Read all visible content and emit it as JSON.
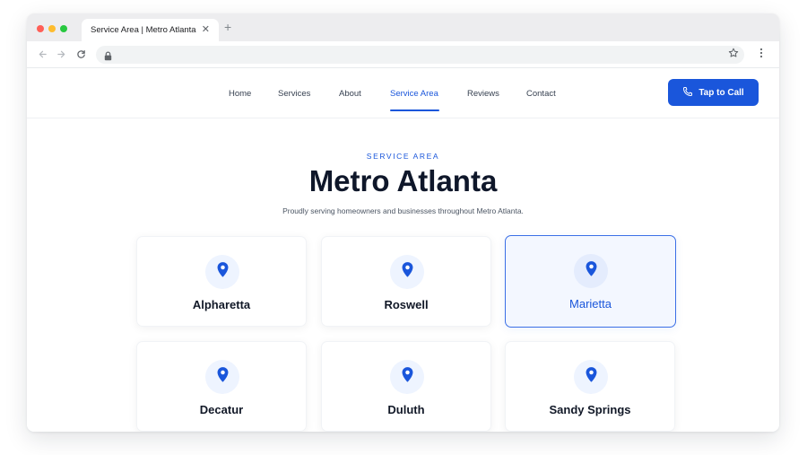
{
  "browser": {
    "tab_title": "Service Area | Metro Atlanta",
    "tab_close_glyph": "✕",
    "new_tab_glyph": "+",
    "icons": [
      "back-arrow-icon",
      "forward-arrow-icon",
      "reload-icon",
      "lock-icon",
      "star-icon",
      "kebab-menu-icon"
    ]
  },
  "nav": {
    "links": [
      "Home",
      "Services",
      "About",
      "Service Area",
      "Reviews",
      "Contact"
    ],
    "active_link": "Service Area",
    "cta_label": "Tap to Call",
    "cta_icon": "phone-icon"
  },
  "hero": {
    "eyebrow": "SERVICE AREA",
    "title": "Metro Atlanta",
    "subtitle": "Proudly serving homeowners and businesses throughout Metro Atlanta."
  },
  "areas": [
    {
      "name": "Alpharetta",
      "selected": false
    },
    {
      "name": "Roswell",
      "selected": false
    },
    {
      "name": "Marietta",
      "selected": true
    },
    {
      "name": "Decatur",
      "selected": false
    },
    {
      "name": "Duluth",
      "selected": false
    },
    {
      "name": "Sandy Springs",
      "selected": false
    }
  ],
  "colors": {
    "accent": "#1a56db",
    "heading": "#0f172a",
    "selected_card_bg": "#f3f7ff",
    "pin_circle_bg": "#eef4ff"
  }
}
